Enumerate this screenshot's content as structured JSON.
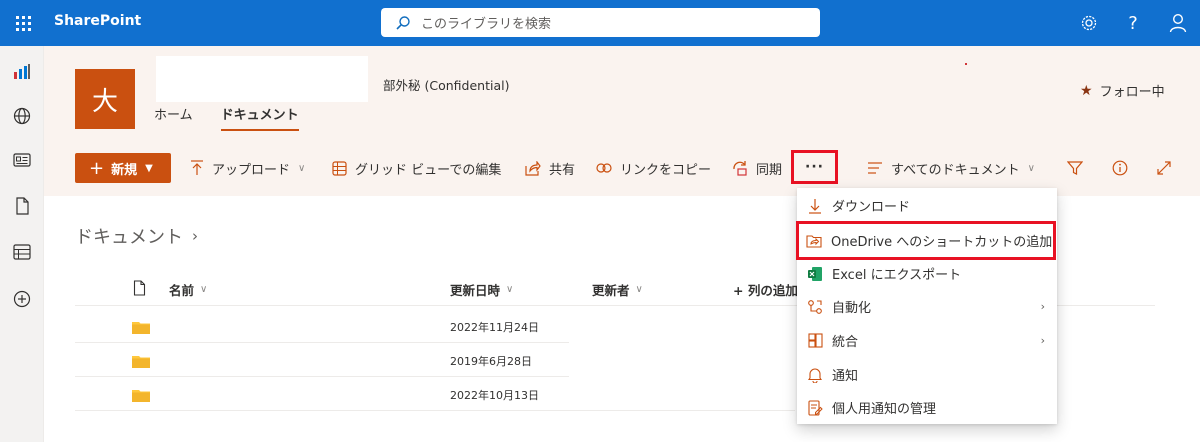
{
  "suite": {
    "brand": "SharePoint",
    "search_placeholder": "このライブラリを検索",
    "icons": [
      "waffle-icon",
      "settings-icon",
      "help-icon",
      "profile-icon"
    ]
  },
  "rail": {
    "icons": [
      "app-icon",
      "globe-icon",
      "news-icon",
      "document-icon",
      "list-icon",
      "add-icon"
    ]
  },
  "site": {
    "logo_letter": "大",
    "classification": "部外秘 (Confidential)",
    "nav": [
      "ホーム",
      "ドキュメント"
    ],
    "follow_label": "フォロー中",
    "accent": "#ca5010"
  },
  "commands": {
    "new_label": "新規",
    "upload_label": "アップロード",
    "grid_edit_label": "グリッド ビューでの編集",
    "share_label": "共有",
    "copy_link_label": "リンクをコピー",
    "sync_label": "同期",
    "more_label": "···",
    "view_label": "すべてのドキュメント"
  },
  "library": {
    "breadcrumb": "ドキュメント",
    "columns": {
      "name": "名前",
      "modified": "更新日時",
      "modified_by": "更新者",
      "add_column": "+ 列の追加"
    },
    "rows": [
      {
        "modified": "2022年11月24日"
      },
      {
        "modified": "2019年6月28日"
      },
      {
        "modified": "2022年10月13日"
      }
    ]
  },
  "menu": {
    "items": [
      {
        "label": "ダウンロード",
        "icon": "download-icon"
      },
      {
        "label": "OneDrive へのショートカットの追加",
        "icon": "shortcut-icon"
      },
      {
        "label": "Excel にエクスポート",
        "icon": "excel-icon"
      },
      {
        "label": "自動化",
        "icon": "automate-icon"
      },
      {
        "label": "統合",
        "icon": "integrate-icon"
      },
      {
        "label": "通知",
        "icon": "bell-icon"
      },
      {
        "label": "個人用通知の管理",
        "icon": "manage-alerts-icon"
      }
    ]
  }
}
